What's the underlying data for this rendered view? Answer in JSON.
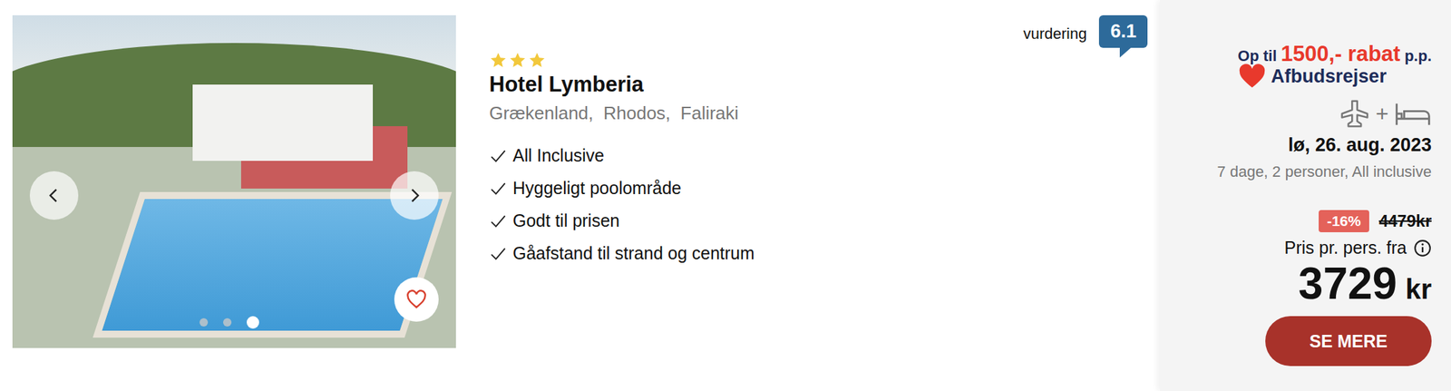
{
  "listing": {
    "stars": 3,
    "title": "Hotel Lymberia",
    "location": "Grækenland,  Rhodos,  Faliraki",
    "features": [
      "All Inclusive",
      "Hyggeligt poolområde",
      "Godt til prisen",
      "Gåafstand til strand og centrum"
    ],
    "favorite": false
  },
  "gallery": {
    "dots": [
      {
        "selected": false
      },
      {
        "selected": false
      },
      {
        "selected": true
      }
    ]
  },
  "rating": {
    "label": "vurdering",
    "score": "6.1"
  },
  "offer": {
    "promo_prefix": "Op til",
    "promo_amount": "1500,- rabat",
    "promo_suffix": "p.p.",
    "promo_brand": "Afbudsrejser",
    "plus": "+",
    "date": "lø, 26. aug. 2023",
    "details": "7 dage, 2 personer, All inclusive",
    "discount": "-16%",
    "old_price": "4479kr",
    "price_label": "Pris pr. pers. fra",
    "price": "3729",
    "currency": "kr",
    "button": "SE MERE"
  }
}
